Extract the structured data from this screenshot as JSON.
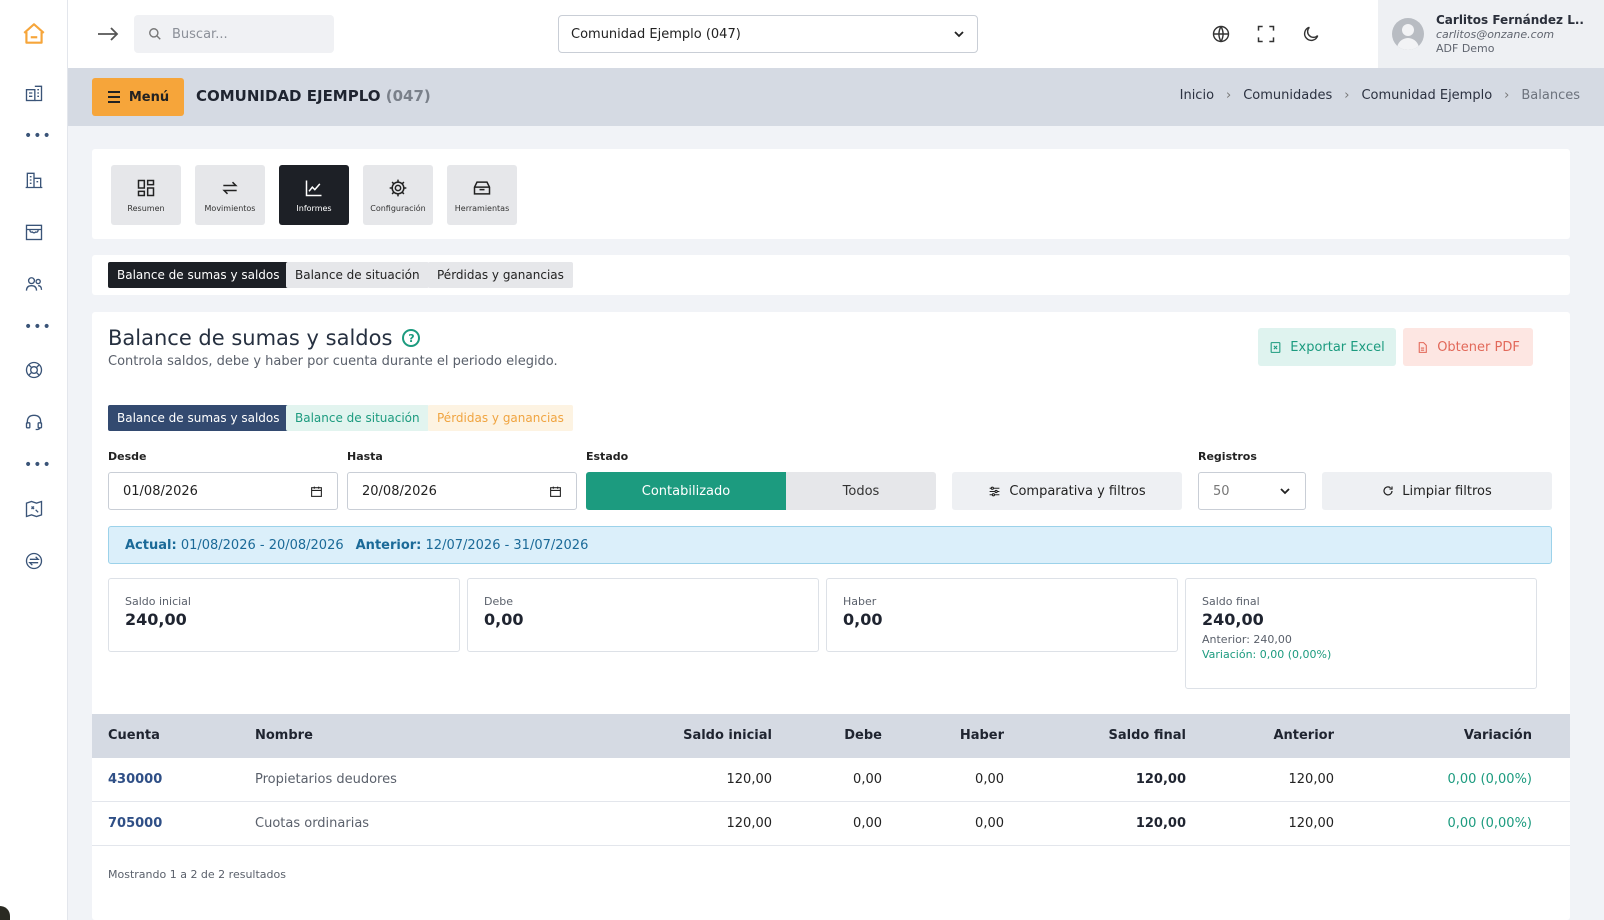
{
  "search": {
    "placeholder": "Buscar..."
  },
  "community_selector": {
    "value": "Comunidad Ejemplo (047)"
  },
  "user": {
    "name": "Carlitos Fernández L..",
    "email": "carlitos@onzane.com",
    "org": "ADF Demo"
  },
  "header": {
    "menu_label": "Menú",
    "title": "COMUNIDAD EJEMPLO",
    "code": "(047)"
  },
  "breadcrumb": [
    "Inicio",
    "Comunidades",
    "Comunidad Ejemplo",
    "Balances"
  ],
  "tiles": [
    {
      "label": "Resumen",
      "icon": "dashboard-icon",
      "active": false
    },
    {
      "label": "Movimientos",
      "icon": "transfer-icon",
      "active": false
    },
    {
      "label": "Informes",
      "icon": "chart-line-icon",
      "active": true
    },
    {
      "label": "Configuración",
      "icon": "gear-icon",
      "active": false
    },
    {
      "label": "Herramientas",
      "icon": "toolbox-icon",
      "active": false
    }
  ],
  "report_tabs": [
    "Balance de sumas y saldos",
    "Balance de situación",
    "Pérdidas y ganancias"
  ],
  "panel": {
    "title": "Balance de sumas y saldos",
    "subtitle": "Controla saldos, debe y haber por cuenta durante el periodo elegido.",
    "export_excel": "Exportar Excel",
    "export_pdf": "Obtener PDF"
  },
  "filters": {
    "desde_label": "Desde",
    "desde_value": "01/08/2026",
    "hasta_label": "Hasta",
    "hasta_value": "20/08/2026",
    "estado_label": "Estado",
    "estado_on": "Contabilizado",
    "estado_off": "Todos",
    "comparativa": "Comparativa y filtros",
    "registros_label": "Registros",
    "registros_value": "50",
    "clear": "Limpiar filtros"
  },
  "period": {
    "actual_label": "Actual:",
    "actual_value": "01/08/2026 - 20/08/2026",
    "anterior_label": "Anterior:",
    "anterior_value": "12/07/2026 - 31/07/2026"
  },
  "stats": {
    "saldo_inicial": {
      "label": "Saldo inicial",
      "value": "240,00"
    },
    "debe": {
      "label": "Debe",
      "value": "0,00"
    },
    "haber": {
      "label": "Haber",
      "value": "0,00"
    },
    "saldo_final": {
      "label": "Saldo final",
      "value": "240,00",
      "anterior": "Anterior: 240,00",
      "variacion": "Variación: 0,00 (0,00%)"
    }
  },
  "table": {
    "headers": [
      "Cuenta",
      "Nombre",
      "Saldo inicial",
      "Debe",
      "Haber",
      "Saldo final",
      "Anterior",
      "Variación"
    ],
    "rows": [
      [
        "430000",
        "Propietarios deudores",
        "120,00",
        "0,00",
        "0,00",
        "120,00",
        "120,00",
        "0,00 (0,00%)"
      ],
      [
        "705000",
        "Cuotas ordinarias",
        "120,00",
        "0,00",
        "0,00",
        "120,00",
        "120,00",
        "0,00 (0,00%)"
      ]
    ],
    "footer": "Mostrando 1 a 2 de 2 resultados"
  },
  "colors": {
    "accent": "#f6a53a",
    "teal": "#1c9b7f",
    "navy": "#334a70",
    "danger": "#e2695a"
  }
}
